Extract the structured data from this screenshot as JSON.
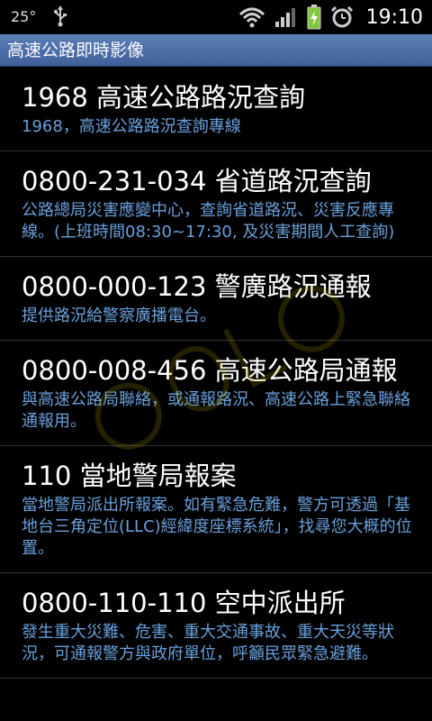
{
  "status_bar": {
    "temperature": "25°",
    "time": "19:10",
    "icons": [
      "usb-icon",
      "wifi-icon",
      "signal-icon",
      "battery-icon",
      "alarm-icon"
    ]
  },
  "app": {
    "title": "高速公路即時影像"
  },
  "items": [
    {
      "title": "1968 高速公路路況查詢",
      "desc": "1968，高速公路路況查詢專線"
    },
    {
      "title": "0800-231-034 省道路況查詢",
      "desc": "公路總局災害應變中心，查詢省道路況、災害反應專線。(上班時間08:30~17:30, 及災害期間人工查詢)"
    },
    {
      "title": "0800-000-123 警廣路況通報",
      "desc": "提供路況給警察廣播電台。"
    },
    {
      "title": "0800-008-456 高速公路局通報",
      "desc": "與高速公路局聯絡，或通報路況、高速公路上緊急聯絡通報用。"
    },
    {
      "title": "110 當地警局報案",
      "desc": "當地警局派出所報案。如有緊急危難，警方可透過「基地台三角定位(LLC)經緯度座標系統」，找尋您大概的位置。"
    },
    {
      "title": "0800-110-110 空中派出所",
      "desc": "發生重大災難、危害、重大交通事故、重大天災等狀況，可通報警方與政府單位，呼籲民眾緊急避難。"
    }
  ],
  "colors": {
    "title_bar": "#4a6ea8",
    "desc_text": "#69a0dc",
    "battery": "#7ec83a"
  }
}
